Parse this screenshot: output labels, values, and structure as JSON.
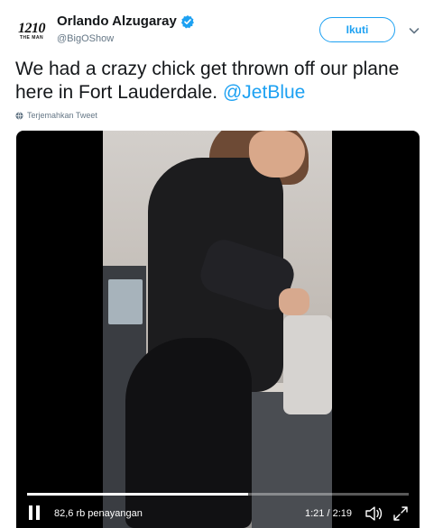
{
  "user": {
    "avatar_text": "1210",
    "avatar_subtext": "THE MAN",
    "display_name": "Orlando Alzugaray",
    "verified_icon": "verified-badge-icon",
    "handle": "@BigOShow"
  },
  "actions": {
    "follow_label": "Ikuti",
    "menu_icon": "chevron-down-icon"
  },
  "tweet": {
    "text": "We had a crazy chick get thrown off our plane here in Fort Lauderdale. ",
    "mention": "@JetBlue",
    "translate_label": "Terjemahkan Tweet",
    "translate_icon": "globe-icon"
  },
  "video": {
    "views": "82,6 rb penayangan",
    "time": "1:21 / 2:19",
    "progress": 0.58,
    "pause_icon": "pause-icon",
    "volume_icon": "volume-icon",
    "fullscreen_icon": "fullscreen-icon"
  },
  "colors": {
    "accent": "#1da1f2",
    "secondary_text": "#657786",
    "video_bg": "#000000"
  }
}
